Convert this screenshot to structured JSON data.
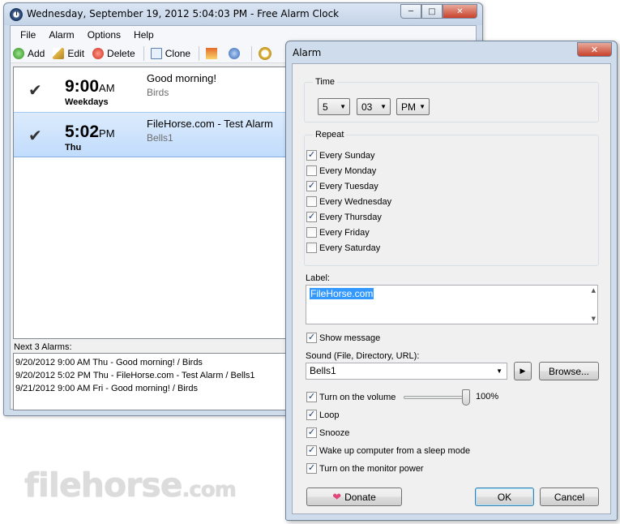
{
  "main": {
    "title": "Wednesday, September 19, 2012 5:04:03 PM - Free Alarm Clock",
    "menu": [
      "File",
      "Alarm",
      "Options",
      "Help"
    ],
    "toolbar": {
      "add": "Add",
      "edit": "Edit",
      "delete": "Delete",
      "clone": "Clone"
    },
    "alarms": [
      {
        "time": "9:00",
        "ampm": "AM",
        "days": "Weekdays",
        "label": "Good morning!",
        "sound": "Birds",
        "enabled": true
      },
      {
        "time": "5:02",
        "ampm": "PM",
        "days": "Thu",
        "label": "FileHorse.com - Test Alarm",
        "sound": "Bells1",
        "enabled": true
      }
    ],
    "next_label": "Next 3 Alarms:",
    "next": [
      "9/20/2012 9:00 AM Thu - Good morning! / Birds",
      "9/20/2012 5:02 PM Thu - FileHorse.com - Test Alarm / Bells1",
      "9/21/2012 9:00 AM Fri - Good morning! / Birds"
    ]
  },
  "watermark": {
    "text": "filehorse",
    "suffix": ".com"
  },
  "dialog": {
    "title": "Alarm",
    "time_group": "Time",
    "hour": "5",
    "minute": "03",
    "ampm": "PM",
    "repeat_group": "Repeat",
    "days": [
      {
        "label": "Every Sunday",
        "checked": true
      },
      {
        "label": "Every Monday",
        "checked": false
      },
      {
        "label": "Every Tuesday",
        "checked": true
      },
      {
        "label": "Every Wednesday",
        "checked": false
      },
      {
        "label": "Every Thursday",
        "checked": true
      },
      {
        "label": "Every Friday",
        "checked": false
      },
      {
        "label": "Every Saturday",
        "checked": false
      }
    ],
    "label_caption": "Label:",
    "label_value": "FileHorse.com",
    "show_message": "Show message",
    "sound_caption": "Sound (File, Directory, URL):",
    "sound_value": "Bells1",
    "browse": "Browse...",
    "volume_label": "Turn on the volume",
    "volume_value": "100%",
    "volume_fraction": 1.0,
    "loop": "Loop",
    "snooze": "Snooze",
    "wake": "Wake up computer from a sleep mode",
    "monitor": "Turn on the monitor power",
    "donate": "Donate",
    "ok": "OK",
    "cancel": "Cancel"
  }
}
